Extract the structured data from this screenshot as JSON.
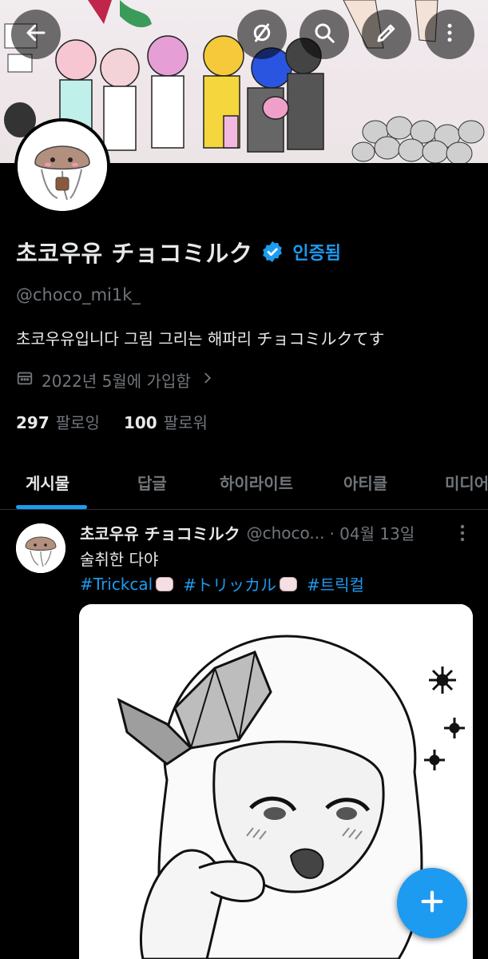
{
  "banner": {
    "back_icon": "arrow-left-icon",
    "grok_icon": "circle-slash-icon",
    "search_icon": "search-icon",
    "edit_icon": "pencil-icon",
    "more_icon": "more-vertical-icon"
  },
  "profile": {
    "display_name": "초코우유 チョコミルク",
    "verified_label": "인증됨",
    "handle": "@choco_mi1k_",
    "bio": "초코우유입니다 그림 그리는 해파리 チョコミルクてす",
    "joined": "2022년 5월에 가입함",
    "following_count": "297",
    "following_label": "팔로잉",
    "followers_count": "100",
    "followers_label": "팔로워"
  },
  "tabs": [
    {
      "label": "게시물",
      "active": true
    },
    {
      "label": "답글",
      "active": false
    },
    {
      "label": "하이라이트",
      "active": false
    },
    {
      "label": "아티클",
      "active": false
    },
    {
      "label": "미디어",
      "active": false
    }
  ],
  "post": {
    "author_name": "초코우유 チョコミルク",
    "author_handle": "@choco...",
    "date": "· 04월 13일",
    "text": "술취한 다야",
    "hashtags": [
      "#Trickcal",
      "#トリッカル",
      "#트릭컬"
    ]
  },
  "colors": {
    "accent": "#1d9bf0",
    "background": "#000000",
    "text_primary": "#e7e9ea",
    "text_secondary": "#71767b"
  },
  "fab_icon": "plus-icon"
}
